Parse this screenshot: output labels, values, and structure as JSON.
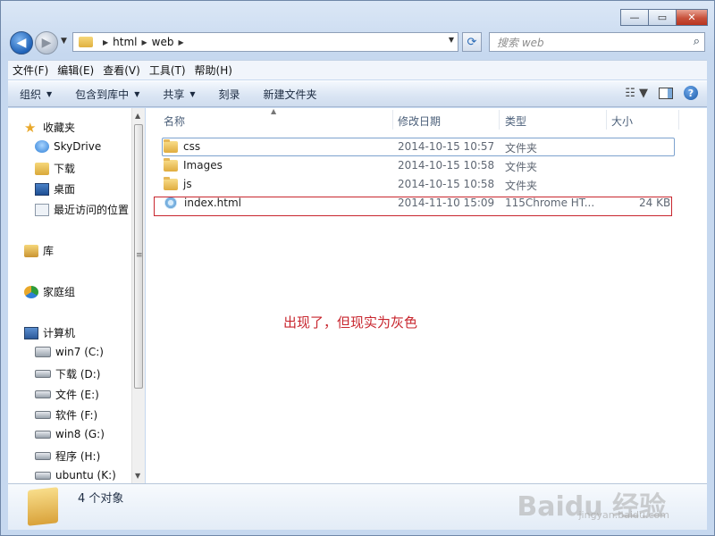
{
  "window": {
    "caption_buttons": {
      "minimize": "—",
      "maximize": "▭",
      "close": "✕"
    }
  },
  "address": {
    "segments": [
      "html",
      "web"
    ],
    "search_placeholder": "搜索 web"
  },
  "menu": [
    "文件(F)",
    "编辑(E)",
    "查看(V)",
    "工具(T)",
    "帮助(H)"
  ],
  "toolbar": {
    "organize": "组织",
    "include_in_library": "包含到库中",
    "share": "共享",
    "burn": "刻录",
    "new_folder": "新建文件夹"
  },
  "sidebar": {
    "favorites": "收藏夹",
    "skydrive": "SkyDrive",
    "downloads": "下载",
    "desktop": "桌面",
    "recent": "最近访问的位置",
    "libraries": "库",
    "homegroup": "家庭组",
    "computer": "计算机",
    "drives": [
      "win7 (C:)",
      "下载 (D:)",
      "文件 (E:)",
      "软件 (F:)",
      "win8 (G:)",
      "程序 (H:)",
      "ubuntu (K:)"
    ]
  },
  "columns": {
    "name": "名称",
    "date": "修改日期",
    "type": "类型",
    "size": "大小"
  },
  "files": [
    {
      "name": "css",
      "date": "2014-10-15 10:57",
      "type": "文件夹",
      "size": ""
    },
    {
      "name": "Images",
      "date": "2014-10-15 10:58",
      "type": "文件夹",
      "size": ""
    },
    {
      "name": "js",
      "date": "2014-10-15 10:58",
      "type": "文件夹",
      "size": ""
    },
    {
      "name": "index.html",
      "date": "2014-11-10 15:09",
      "type": "115Chrome HT...",
      "size": "24 KB"
    }
  ],
  "annotation": "出现了，但现实为灰色",
  "status": {
    "count": "4 个对象"
  },
  "watermark": {
    "brand": "Baidu 经验",
    "url": "jingyan.baidu.com"
  },
  "colors": {
    "annotation": "#c8262e",
    "selection_border": "#7da2ce"
  }
}
